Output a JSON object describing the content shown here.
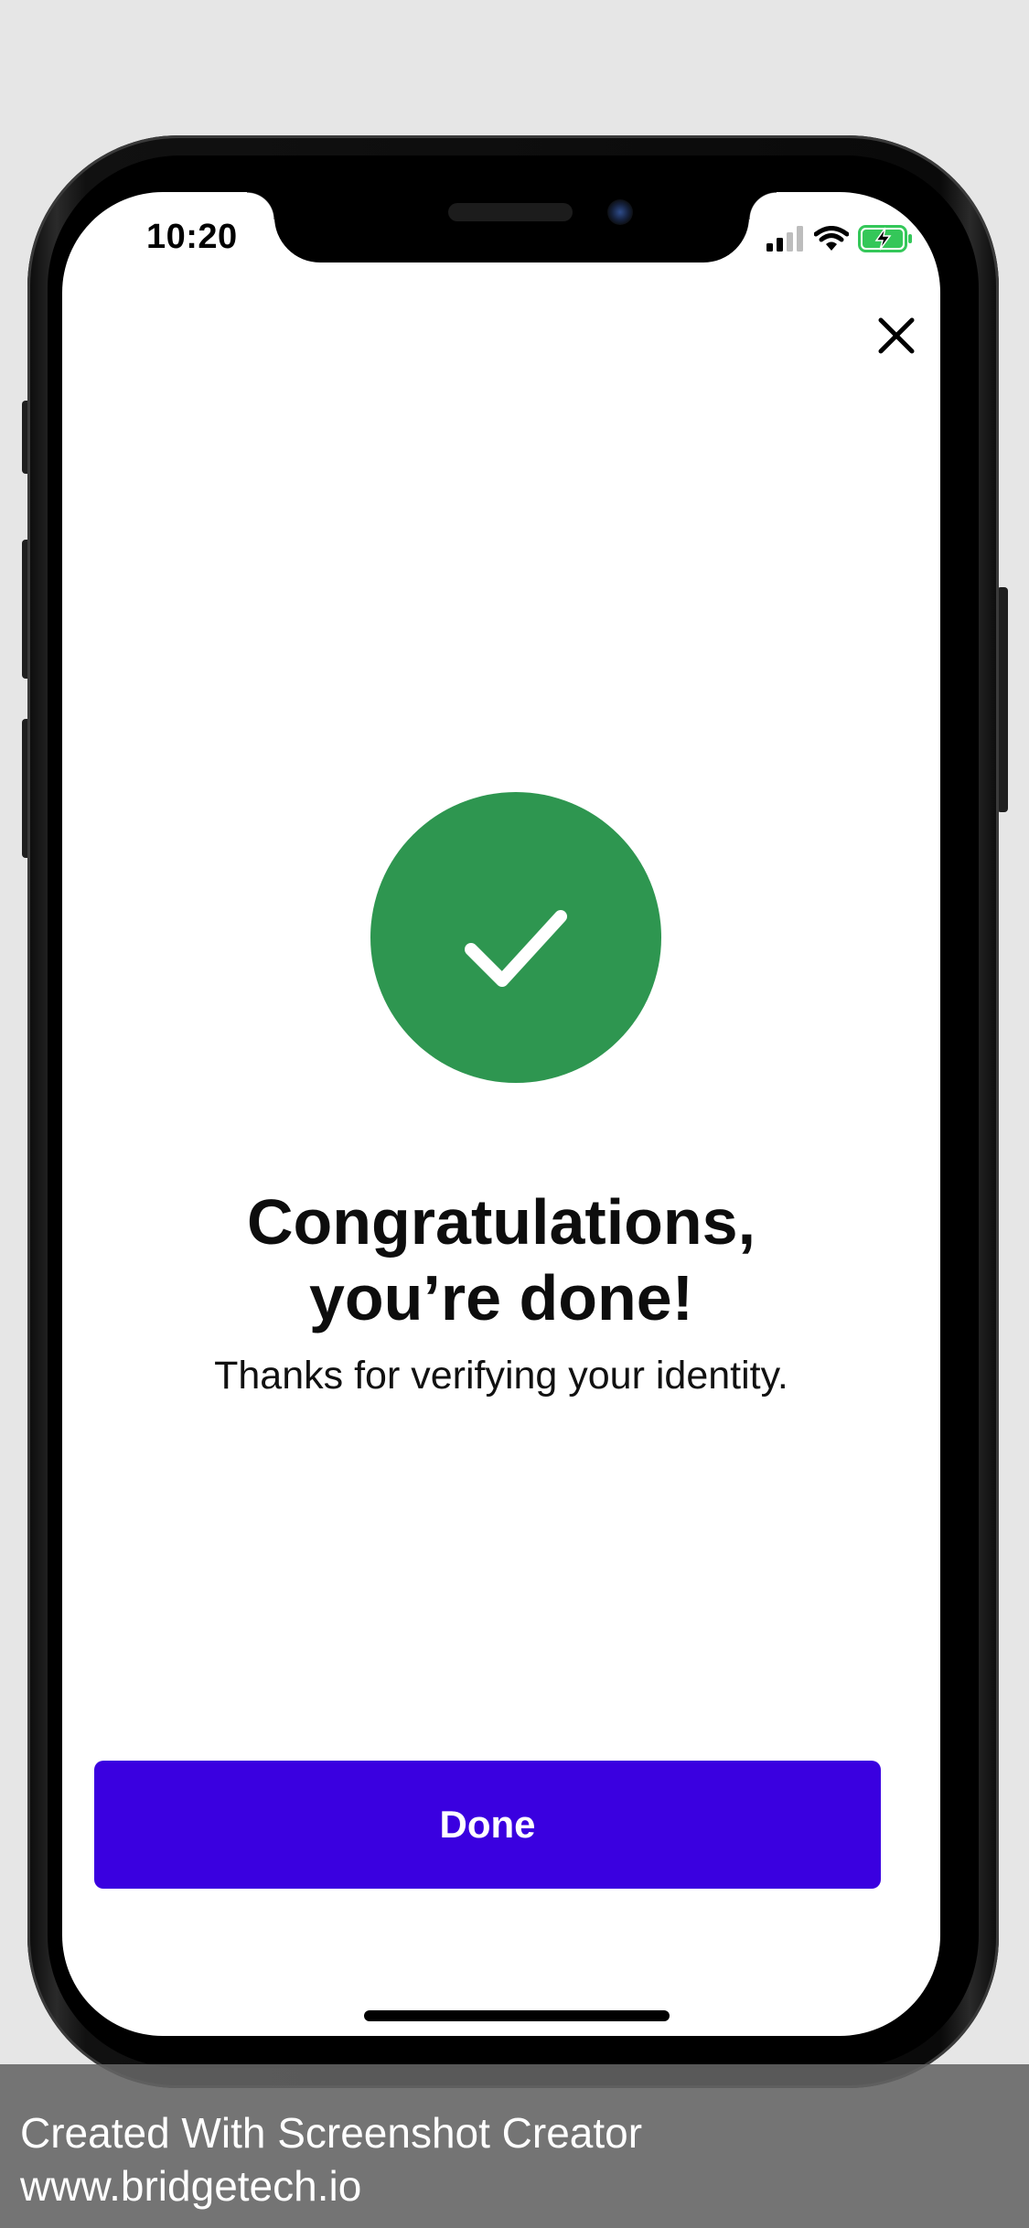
{
  "status_bar": {
    "time": "10:20",
    "signal_icon": "cellular-signal-icon",
    "wifi_icon": "wifi-icon",
    "battery_icon": "battery-charging-icon",
    "battery_color": "#34c759"
  },
  "header": {
    "close_icon": "close-icon"
  },
  "main": {
    "badge_icon": "checkmark-icon",
    "badge_color": "#2e9650",
    "title_line1": "Congratulations,",
    "title_line2": "you’re done!",
    "subtitle": "Thanks for verifying your identity.",
    "done_label": "Done",
    "done_color": "#3a00e0"
  },
  "footer": {
    "line1": "Created With Screenshot Creator",
    "line2": "www.bridgetech.io"
  }
}
